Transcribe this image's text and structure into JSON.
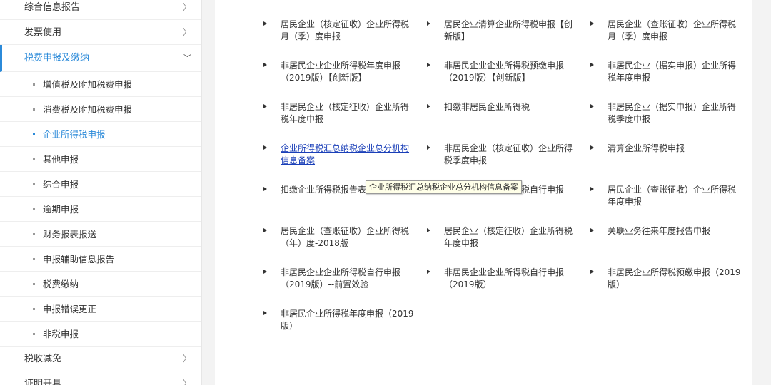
{
  "sidebar": {
    "items": [
      {
        "label": "综合信息报告",
        "chevron": "〉"
      },
      {
        "label": "发票使用",
        "chevron": "〉"
      },
      {
        "label": "税费申报及缴纳",
        "chevron": "﹀"
      },
      {
        "label": "税收减免",
        "chevron": "〉"
      },
      {
        "label": "证明开具",
        "chevron": "〉"
      }
    ],
    "subitems": [
      {
        "label": "增值税及附加税费申报"
      },
      {
        "label": "消费税及附加税费申报"
      },
      {
        "label": "企业所得税申报"
      },
      {
        "label": "其他申报"
      },
      {
        "label": "综合申报"
      },
      {
        "label": "逾期申报"
      },
      {
        "label": "财务报表报送"
      },
      {
        "label": "申报辅助信息报告"
      },
      {
        "label": "税费缴纳"
      },
      {
        "label": "申报错误更正"
      },
      {
        "label": "非税申报"
      }
    ],
    "accent_color": "#2b8ad9"
  },
  "main": {
    "rows": [
      [
        "居民企业（核定征收）企业所得税月（季）度申报",
        "居民企业清算企业所得税申报【创新版】",
        "居民企业（查账征收）企业所得税月（季）度申报"
      ],
      [
        "非居民企业企业所得税年度申报（2019版）【创新版】",
        "非居民企业企业所得税预缴申报（2019版）【创新版】",
        "非居民企业（据实申报）企业所得税年度申报"
      ],
      [
        "非居民企业（核定征收）企业所得税年度申报",
        "扣缴非居民企业所得税",
        "非居民企业（据实申报）企业所得税季度申报"
      ],
      [
        "企业所得税汇总纳税企业总分机构信息备案",
        "非居民企业（核定征收）企业所得税季度申报",
        "清算企业所得税申报"
      ],
      [
        "扣缴企业所得税报告表（2019版）",
        "非居民企业企业所得税自行申报",
        "居民企业（查账征收）企业所得税年度申报"
      ],
      [
        "居民企业（查账征收）企业所得税（年）度-2018版",
        "居民企业（核定征收）企业所得税年度申报",
        "关联业务往来年度报告申报"
      ],
      [
        "非居民企业企业所得税自行申报（2019版）--前置效验",
        "非居民企业企业所得税自行申报（2019版）",
        "非居民企业所得税预缴申报（2019版）"
      ],
      [
        "非居民企业所得税年度申报（2019版）"
      ]
    ],
    "tooltip": "企业所得税汇总纳税企业总分机构信息备案",
    "link_hover_color": "#1a3fb8"
  }
}
